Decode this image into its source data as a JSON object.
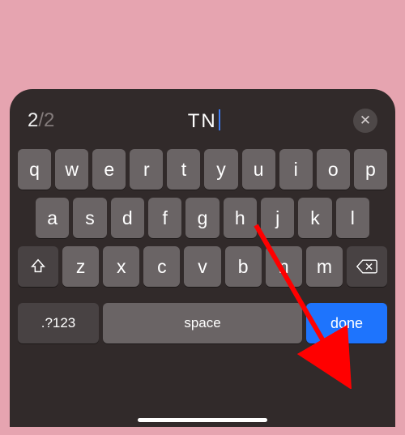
{
  "bg_preview_text": "TN",
  "header": {
    "counter_current": "2",
    "counter_separator": "/",
    "counter_total": "2",
    "input_value": "TN",
    "clear_glyph": "✕"
  },
  "rows": {
    "r1": [
      "q",
      "w",
      "e",
      "r",
      "t",
      "y",
      "u",
      "i",
      "o",
      "p"
    ],
    "r2": [
      "a",
      "s",
      "d",
      "f",
      "g",
      "h",
      "j",
      "k",
      "l"
    ],
    "r3": [
      "z",
      "x",
      "c",
      "v",
      "b",
      "n",
      "m"
    ]
  },
  "mods": {
    "numsym": ".?123",
    "space": "space",
    "done": "done"
  },
  "annotation": {
    "arrow_color": "#ff0000"
  }
}
